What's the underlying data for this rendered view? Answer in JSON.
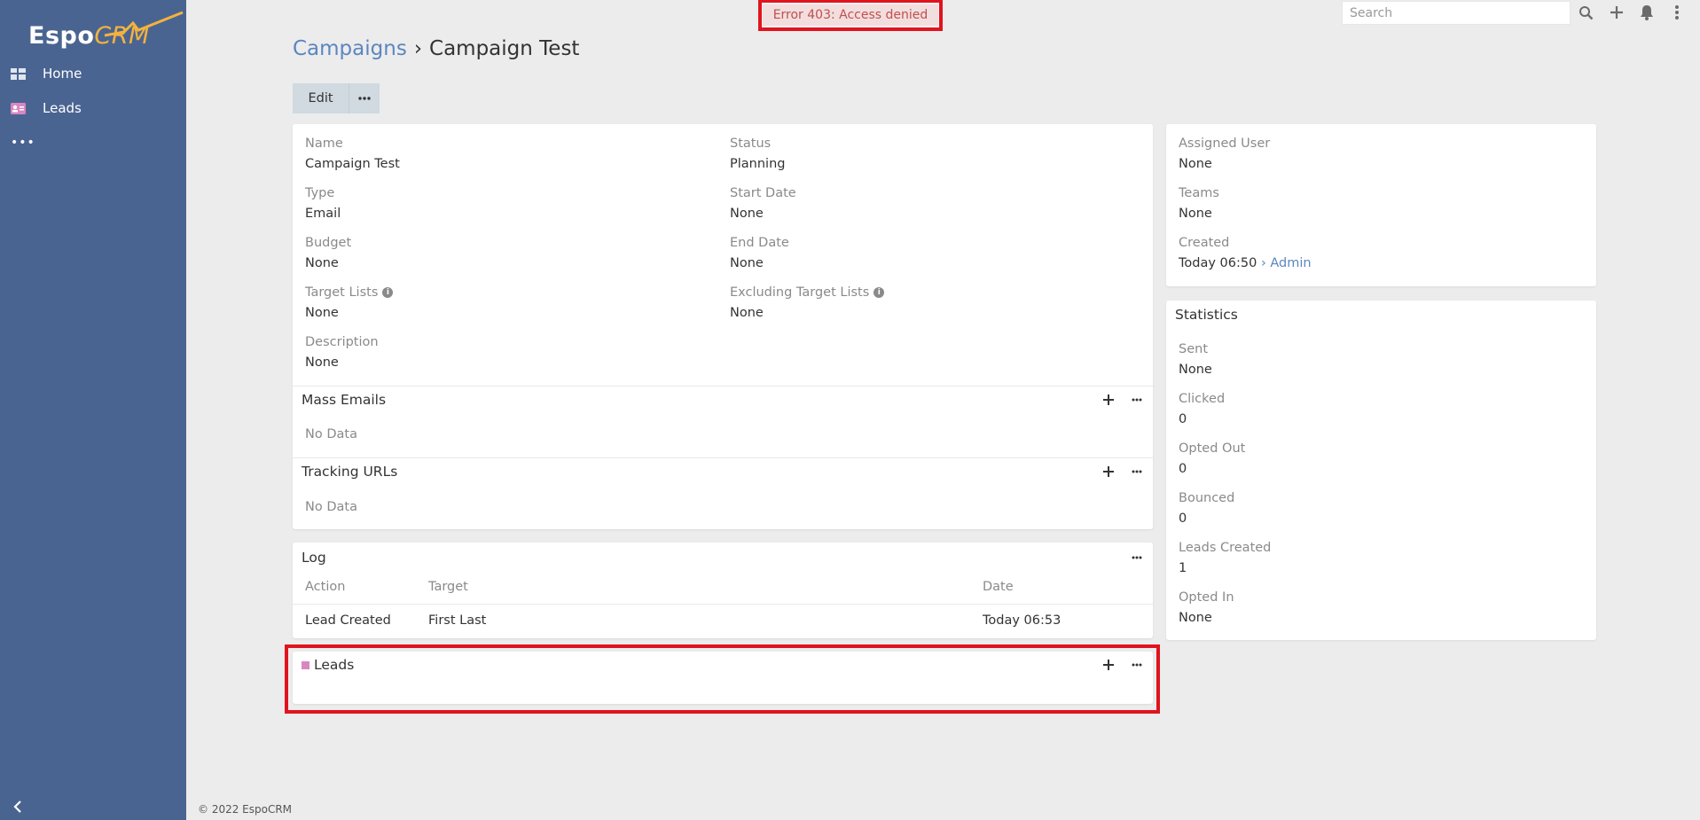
{
  "app": {
    "logo_text_1": "Espo",
    "logo_text_2": "CRM"
  },
  "sidebar": {
    "items": [
      {
        "label": "Home",
        "icon": "dashboard-grid-icon"
      },
      {
        "label": "Leads",
        "icon": "id-card-icon"
      }
    ],
    "more_label": "•••"
  },
  "topbar": {
    "error_text": "Error 403: Access denied",
    "search_placeholder": "Search"
  },
  "header": {
    "breadcrumb_parent": "Campaigns",
    "separator": "›",
    "title": "Campaign Test"
  },
  "actions": {
    "edit_label": "Edit"
  },
  "details": {
    "name_label": "Name",
    "name_value": "Campaign Test",
    "status_label": "Status",
    "status_value": "Planning",
    "type_label": "Type",
    "type_value": "Email",
    "start_date_label": "Start Date",
    "start_date_value": "None",
    "budget_label": "Budget",
    "budget_value": "None",
    "end_date_label": "End Date",
    "end_date_value": "None",
    "target_lists_label": "Target Lists",
    "target_lists_value": "None",
    "excluding_label": "Excluding Target Lists",
    "excluding_value": "None",
    "description_label": "Description",
    "description_value": "None"
  },
  "mass_emails": {
    "title": "Mass Emails",
    "empty": "No Data"
  },
  "tracking_urls": {
    "title": "Tracking URLs",
    "empty": "No Data"
  },
  "log": {
    "title": "Log",
    "columns": [
      "Action",
      "Target",
      "Date"
    ],
    "rows": [
      {
        "action": "Lead Created",
        "target": "First Last",
        "date": "Today 06:53"
      }
    ]
  },
  "leads_panel": {
    "title": "Leads"
  },
  "side": {
    "assigned_user_label": "Assigned User",
    "assigned_user_value": "None",
    "teams_label": "Teams",
    "teams_value": "None",
    "created_label": "Created",
    "created_value": "Today 06:50",
    "created_by": "› Admin"
  },
  "statistics": {
    "title": "Statistics",
    "items": [
      {
        "label": "Sent",
        "value": "None"
      },
      {
        "label": "Clicked",
        "value": "0"
      },
      {
        "label": "Opted Out",
        "value": "0"
      },
      {
        "label": "Bounced",
        "value": "0"
      },
      {
        "label": "Leads Created",
        "value": "1"
      },
      {
        "label": "Opted In",
        "value": "None"
      }
    ]
  },
  "footer": {
    "text": "© 2022 EspoCRM"
  },
  "colors": {
    "sidebar": "#4a6492",
    "link": "#5c86c0",
    "highlight": "#e0141e",
    "error_bg": "#f2dede",
    "lead_badge": "#d987c1"
  }
}
